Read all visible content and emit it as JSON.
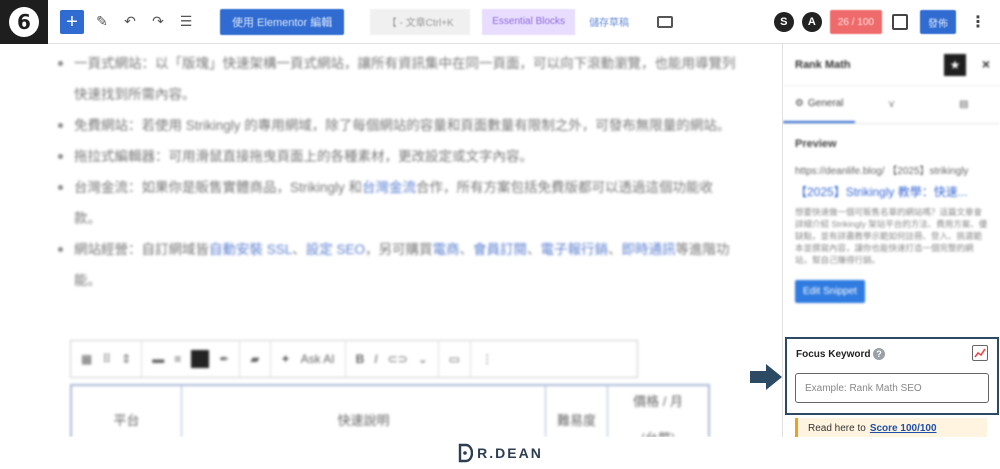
{
  "toolbar": {
    "logo_glyph": "6",
    "add_glyph": "+",
    "elementor_label": "使用 Elementor 編輯",
    "search_label": "【 - 文章Ctrl+K",
    "essential_blocks_label": "Essential Blocks",
    "save_draft_label": "儲存草稿",
    "icon_s": "S",
    "icon_a": "A",
    "rank_score": "26 / 100",
    "publish_label": "發佈",
    "more_glyph": "⋮"
  },
  "editor": {
    "bullets": [
      {
        "parts": [
          {
            "text": "一頁式網站：以「版塊」快速架構一頁式網站，讓所有資訊集中在同一頁面，可以向下滾動瀏覽，也能用導覽列快速找到所需內容。",
            "link": false
          }
        ]
      },
      {
        "parts": [
          {
            "text": "免費網站：若使用 Strikingly 的專用網域，除了每個網站的容量和頁面數量有限制之外，可發布無限量的網站。",
            "link": false
          }
        ]
      },
      {
        "parts": [
          {
            "text": "拖拉式編輯器：可用滑鼠直接拖曳頁面上的各種素材，更改設定或文字內容。",
            "link": false
          }
        ]
      },
      {
        "parts": [
          {
            "text": "台灣金流：如果你是販售實體商品，Strikingly 和",
            "link": false
          },
          {
            "text": "台灣金流",
            "link": true
          },
          {
            "text": "合作，所有方案包括免費版都可以透過這個功能收款。",
            "link": false
          }
        ]
      },
      {
        "parts": [
          {
            "text": "網站經營：自訂網域皆",
            "link": false
          },
          {
            "text": "自動安裝 SSL",
            "link": true
          },
          {
            "text": "、",
            "link": false
          },
          {
            "text": "設定 SEO",
            "link": true
          },
          {
            "text": "，另可購買",
            "link": false
          },
          {
            "text": "電商",
            "link": true
          },
          {
            "text": "、",
            "link": false
          },
          {
            "text": "會員訂閱",
            "link": true
          },
          {
            "text": "、",
            "link": false
          },
          {
            "text": "電子報行銷",
            "link": true
          },
          {
            "text": "、",
            "link": false
          },
          {
            "text": "即時通訊",
            "link": true
          },
          {
            "text": "等進階功能。",
            "link": false
          }
        ]
      }
    ],
    "block_toolbar": {
      "ask_ai": "Ask AI",
      "bold": "B",
      "italic": "I"
    },
    "table_headers": [
      "平台",
      "快速說明",
      "難易度",
      "價格 / 月"
    ],
    "table_header_sub": "(台幣)"
  },
  "sidebar": {
    "title": "Rank Math",
    "close_glyph": "×",
    "tabs": [
      {
        "label": "General"
      },
      {
        "label": ""
      },
      {
        "label": ""
      }
    ],
    "preview_label": "Preview",
    "preview_url": "https://deanlife.blog/ 【2025】strikingly",
    "preview_title": "【2025】Strikingly 教學：快速...",
    "preview_desc": "想要快速做一個可販售名單的網站嗎？這篇文章會詳細介紹 Strikingly 架站平台的方法、費用方案、優缺點，並有詳盡教學示範如何註冊、登入、挑選範本並撰寫內容，讓你也能快速打造一個完整的網站，幫自己賺得行銷。",
    "edit_snippet": "Edit Snippet",
    "focus_keyword_label": "Focus Keyword",
    "focus_keyword_help": "?",
    "focus_keyword_placeholder": "Example: Rank Math SEO",
    "focus_keyword_value": "",
    "read_here": "Read here to",
    "score_link": "Score 100/100"
  },
  "footer": {
    "brand": "R.DEAN"
  },
  "colors": {
    "accent": "#2f6bd1",
    "highlight_border": "#2c4a63",
    "arrow": "#2c4a63",
    "score_badge": "#ef6b6b"
  }
}
